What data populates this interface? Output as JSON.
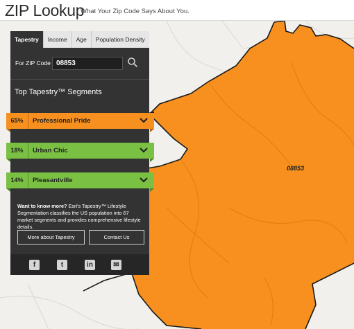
{
  "header": {
    "title": "ZIP Lookup",
    "subtitle": "What Your Zip Code Says About You."
  },
  "map": {
    "zip_label": "08853",
    "region_color": "#f7901e",
    "boundary_color": "#1a1a1a"
  },
  "panel": {
    "tabs": [
      {
        "label": "Tapestry",
        "active": true
      },
      {
        "label": "Income",
        "active": false
      },
      {
        "label": "Age",
        "active": false
      },
      {
        "label": "Population Density",
        "active": false
      }
    ],
    "zip_label": "For ZIP Code",
    "zip_value": "08853",
    "search_icon": "search-icon",
    "segments_title": "Top Tapestry™ Segments",
    "segments": [
      {
        "percent": "65%",
        "name": "Professional Pride",
        "color": "#f7901e",
        "fold_color": "#b3650f"
      },
      {
        "percent": "18%",
        "name": "Urban Chic",
        "color": "#7ac143",
        "fold_color": "#4d8a22"
      },
      {
        "percent": "14%",
        "name": "Pleasantville",
        "color": "#7ac143",
        "fold_color": "#4d8a22"
      }
    ],
    "info_bold": "Want to know more?",
    "info_text": " Esri's Tapestry™ Lifestyle Segmentation classifies the US population into 67 market segments and provides comprehensive lifestyle details.",
    "more_button": "More about Tapestry",
    "contact_button": "Contact Us",
    "social": [
      {
        "icon": "facebook-icon",
        "glyph": "f"
      },
      {
        "icon": "twitter-icon",
        "glyph": "t"
      },
      {
        "icon": "linkedin-icon",
        "glyph": "in"
      },
      {
        "icon": "email-icon",
        "glyph": "✉"
      }
    ]
  }
}
